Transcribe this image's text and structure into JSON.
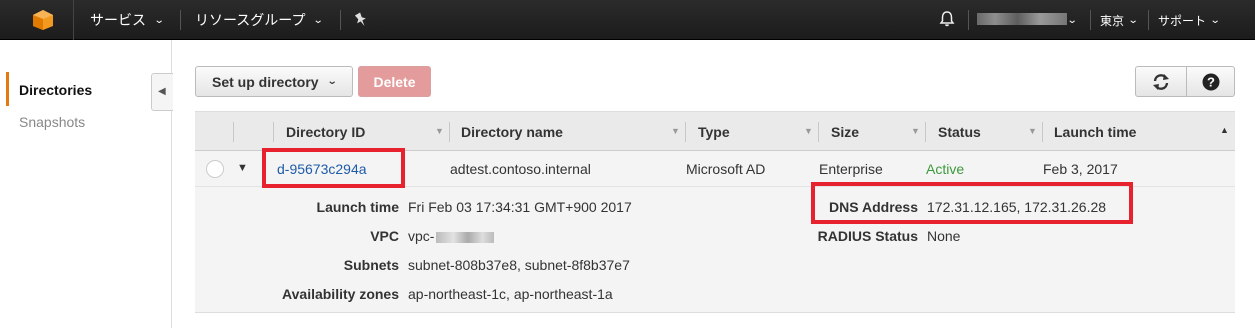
{
  "nav": {
    "services": "サービス",
    "resource_groups": "リソースグループ",
    "region": "東京",
    "support": "サポート"
  },
  "sidebar": {
    "items": [
      {
        "label": "Directories",
        "active": true
      },
      {
        "label": "Snapshots",
        "active": false
      }
    ]
  },
  "toolbar": {
    "setup_label": "Set up directory",
    "delete_label": "Delete"
  },
  "table": {
    "columns": [
      "Directory ID",
      "Directory name",
      "Type",
      "Size",
      "Status",
      "Launch time"
    ],
    "rows": [
      {
        "directory_id": "d-95673c294a",
        "directory_name": "adtest.contoso.internal",
        "type": "Microsoft AD",
        "size": "Enterprise",
        "status": "Active",
        "launch_time": "Feb 3, 2017"
      }
    ]
  },
  "details": {
    "launch_time_label": "Launch time",
    "launch_time_value": "Fri Feb 03 17:34:31 GMT+900 2017",
    "vpc_label": "VPC",
    "vpc_value": "vpc-",
    "subnets_label": "Subnets",
    "subnets_value": "subnet-808b37e8, subnet-8f8b37e7",
    "az_label": "Availability zones",
    "az_value": "ap-northeast-1c, ap-northeast-1a",
    "dns_label": "DNS Address",
    "dns_value": "172.31.12.165, 172.31.26.28",
    "radius_label": "RADIUS Status",
    "radius_value": "None"
  },
  "colors": {
    "accent": "#e47911",
    "highlight": "#e8212f",
    "link": "#1e5ba8",
    "active": "#3c9a3c"
  }
}
